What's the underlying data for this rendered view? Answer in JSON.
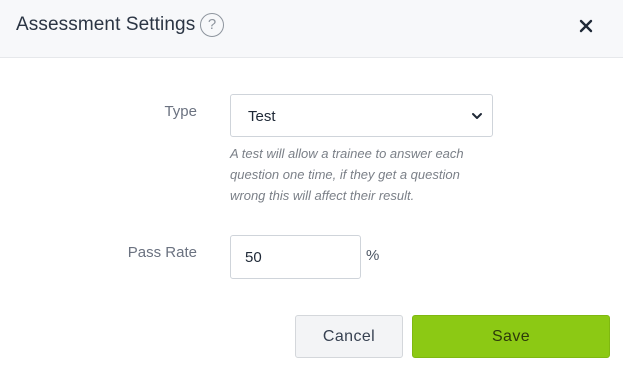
{
  "header": {
    "title": "Assessment Settings",
    "help_icon": "question-circle-icon",
    "help_glyph": "?",
    "close_icon": "close-icon"
  },
  "form": {
    "type": {
      "label": "Type",
      "selected": "Test",
      "hint": "A test will allow a trainee to answer each question one time, if they get a question wrong this will affect their result."
    },
    "pass_rate": {
      "label": "Pass Rate",
      "value": "50",
      "unit": "%"
    }
  },
  "actions": {
    "cancel_label": "Cancel",
    "save_label": "Save"
  },
  "colors": {
    "save_button": "#8cc914",
    "header_bg": "#f7f8fa"
  }
}
